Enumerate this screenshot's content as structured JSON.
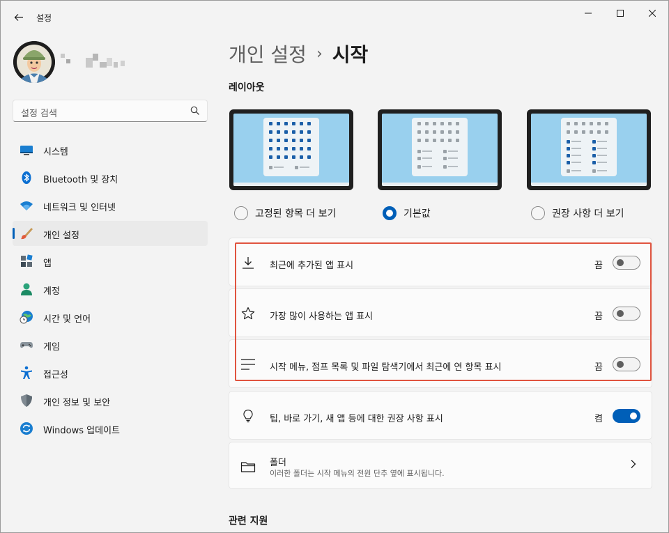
{
  "window": {
    "title": "설정"
  },
  "profile": {
    "avatar": "avatar-image"
  },
  "search": {
    "placeholder": "설정 검색"
  },
  "nav": {
    "items": [
      {
        "label": "시스템",
        "icon": "system-icon"
      },
      {
        "label": "Bluetooth 및 장치",
        "icon": "bluetooth-icon"
      },
      {
        "label": "네트워크 및 인터넷",
        "icon": "wifi-icon"
      },
      {
        "label": "개인 설정",
        "icon": "brush-icon",
        "selected": true
      },
      {
        "label": "앱",
        "icon": "apps-icon"
      },
      {
        "label": "계정",
        "icon": "account-icon"
      },
      {
        "label": "시간 및 언어",
        "icon": "time-language-icon"
      },
      {
        "label": "게임",
        "icon": "gamepad-icon"
      },
      {
        "label": "접근성",
        "icon": "accessibility-icon"
      },
      {
        "label": "개인 정보 및 보안",
        "icon": "shield-icon"
      },
      {
        "label": "Windows 업데이트",
        "icon": "update-icon"
      }
    ]
  },
  "breadcrumb": {
    "parent": "개인 설정",
    "separator": "›",
    "current": "시작"
  },
  "layout": {
    "title": "레이아웃",
    "options": [
      {
        "label": "고정된 항목 더 보기",
        "selected": false
      },
      {
        "label": "기본값",
        "selected": true
      },
      {
        "label": "권장 사항 더 보기",
        "selected": false
      }
    ]
  },
  "settings": [
    {
      "label": "최근에 추가된 앱 표시",
      "state": "끔",
      "on": false,
      "icon": "download-icon"
    },
    {
      "label": "가장 많이 사용하는 앱 표시",
      "state": "끔",
      "on": false,
      "icon": "star-icon"
    },
    {
      "label": "시작 메뉴, 점프 목록 및 파일 탐색기에서 최근에 연 항목 표시",
      "state": "끔",
      "on": false,
      "icon": "list-icon"
    },
    {
      "label": "팁, 바로 가기, 새 앱 등에 대한 권장 사항 표시",
      "state": "켬",
      "on": true,
      "icon": "lightbulb-icon"
    }
  ],
  "folders": {
    "label": "폴더",
    "description": "이러한 폴더는 시작 메뉴의 전원 단추 옆에 표시됩니다.",
    "icon": "folder-icon"
  },
  "related": {
    "title": "관련 지원"
  },
  "colors": {
    "accent": "#005fb8",
    "highlight": "#e0543f"
  }
}
